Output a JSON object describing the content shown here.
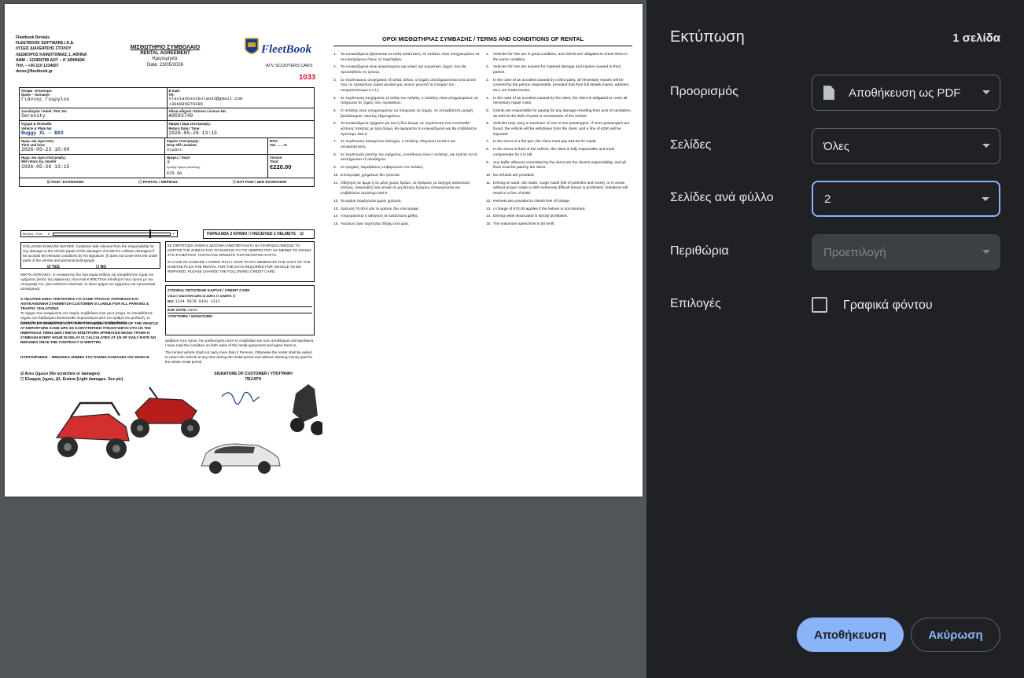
{
  "panel": {
    "title": "Εκτύπωση",
    "page_count": "1 σελίδα",
    "destination": {
      "label": "Προορισμός",
      "value": "Αποθήκευση ως PDF",
      "icon": "pdf-file-icon"
    },
    "pages": {
      "label": "Σελίδες",
      "value": "Όλες"
    },
    "pages_per_sheet": {
      "label": "Σελίδες ανά φύλλο",
      "value": "2"
    },
    "margins": {
      "label": "Περιθώρια",
      "value": "Προεπιλογή"
    },
    "options": {
      "label": "Επιλογές",
      "checkbox_label": "Γραφικά φόντου",
      "checked": false
    },
    "save_button": "Αποθήκευση",
    "cancel_button": "Ακύρωση",
    "accent": "#8ab4f8"
  },
  "contract": {
    "company_lines": [
      "Fleetbook Rentals",
      "FLEETBOOK SOFTWARE I.K.E.",
      "ΛΥΣΕΙΣ ΔΙΑΧΕΙΡΙΣΗΣ ΣΤΟΛΟΥ",
      "ΛΕΩΦΟΡΟΣ ΚΑΙΝΟΤΟΜΙΑΣ 1, ΑΘΗΝΑ",
      "ΑΦΜ – 123456789 ΔΟΥ – Α' ΑΘΗΝΩΝ",
      "ΤΗΛ – +30 210 1234567",
      "demo@fleetbook.gr"
    ],
    "title_gr": "ΜΙΣΘΩΤΗΡΙΟ ΣΥΜΒΟΛΑΙΟ",
    "title_en": "RENTAL AGREEMENT",
    "date_label": "Ημερομηνία:",
    "date_value": "Date: 23/05/2026",
    "brand": "FleetBook",
    "brand_sub": "ATV SCOOTERS CARS",
    "number": "1033",
    "fields": {
      "name_label": "Όνομα - Επώνυμο:",
      "name_label_en": "Name – Surname:",
      "name_value": "Γιάννης Γεωργίου",
      "email_label": "E-mail:",
      "tel_label": "Tel:",
      "email_value": "vlavianosnikolaos2@gmail.com",
      "tel_value": "+306985070285",
      "hotel_label": "Ξενοδοχείο / Hotel / Rm. No:",
      "hotel_value": "Serenity",
      "licence_label": "Άδεια οδηγού / Drivers Licence No:",
      "licence_value": "A0593749",
      "vehicle_label": "Όχημα & Πινακίδα",
      "vehicle_label_en": "Vehicle & Plate No:",
      "vehicle_value": "Buggy XL - B03",
      "return_label": "Ημέρα / Ώρα επιστροφής:",
      "return_label_en": "Return Date / Time:",
      "return_value": "2026-05-26 13:15",
      "out_label": "Ημερ. και ώρα ανάς:",
      "out_label_en": "Time and hour",
      "out_value": "2026-05-23 10:00",
      "dropoff_label": "Σημείο επιστροφής:",
      "dropoff_label_en": "Drop Off Location:",
      "dropoff_value": "Λιμάνι",
      "vat_label": "ΦΠΑ",
      "vat_label_en": "Vat: ……%",
      "willreturn_label": "Ημερ. και ώρα επιστροφής:",
      "willreturn_label_en": "Will return by, time/hr",
      "willreturn_value": "2026-05-26 13:15",
      "days_label": "Ημέρες / Days:",
      "days_value": "3",
      "daily_label": "Αμοιβή Ημέρα (Ανα/Day):",
      "daily_value": "€25.00",
      "total_label": "Σύνολο",
      "total_label_en": "Total:",
      "total_value": "€220.00"
    },
    "payment": [
      "☑ PAID / ΕΞΟΦΛΗΘΗ",
      "☐ PARTIAL / ΜΕΡΙΚΩΣ",
      "☐ NOT PAID / ΔΕΝ ΕΞΟΦΛΗΘΗ"
    ],
    "fuel_label": "Βενζίνη - Fuel",
    "fuel_e": "E",
    "fuel_f": "F",
    "fuel_level": 0.82,
    "helmets": "ΠΑΡΕΛΑΒΑ 2 ΚΡΑΝΗ / I RECEIVED 2 HELMETS",
    "cdw_text": "COLLISION DAMAGE WAIVER. Customer fully relieved from the responsibility for any damage to the vehicle (apart of the damages of € 800 for collision damages) if he accepts the relevant conditions by his signature. (It does not cover tires the under parts of the vehicle and personal belongings)",
    "yes_label": "☑ YES",
    "no_label": "☐ NO",
    "greek_cdw": "ΜΙΚΤΗ ΑΣΦΑΛΕΙΑ. Ο ενοικιαστής δεν έχει καμία ευθύνη για οποιαδήποτε ζημιά του οχήματος (εκτός της αφαίρεσης που είναι € 800) Όταν αποδεχτεί τους όρους με την υπογραφή του. (Δεν καλύπτει ελαστικά, το κάτω τμήμα του οχήματος και προσωπικά αντικείμενα).",
    "legal_text": "Ο ΠΕΛΑΤΗΣ ΕΙΝΑΙ ΥΠΕΥΘΥΝΟΣ ΓΙΑ ΚΑΘΕ ΤΡΟΧΑΙΑ ΠΑΡΑΒΑΣΗ ΚΑΙ ΑΝΤΙΚΑΝΟΝΙΚΗ ΣΤΑΘΜΕΥΣΗ CUSTOMER IS LIABLE FOR ALL PARKING & TRAFFIC VIOLATIONS",
    "legal_sub": "Το όχημα που αναφέρεται στο παρόν συμβόλαιο είναι για 2 άτομα. Σε οποιαδήποτε σημείο του διαδρόμου διαπιστωθεί περισσότεροι από τον αριθμό του μισθωτή, το όχημα θα του αφαιρείται και επιστρέφονται τα χρήματα αδειοδοσίας.",
    "conditions_text": "ΚΑΤΑΣΤΑΣΗ ΟΧΗΜΑΤΟΣ ΚΑΤΑ ΤΗΝ ΠΑΡΑΔΟΣΗ. CONDITIONS OF THE VEHICLE AT DEPARTURE ΚΑΘΕ ΩΡΑ ΣΕ ΚΑΘΥΣΤΕΡΗΣΗ ΥΠΟΛΟΓΙΖΕΤΑΙ ΣΤΟ 1/5 ΤΗΣ ΗΜΕΡΗΣΙΑΣ ΤΙΜΗΣ ΔΕΝ ΓΙΝΕΤΑΙ ΕΠΙΣΤΡΟΦΗ ΧΡΗΜΑΤΩΝ ΜΟΝΟ ΓΡΑΦΗ Η ΣΥΜΒΑΣΗ EVERY HOUR IN DELAY IS CALCULATED AT 1/5 OF DAILY RATE NO REFUNDS ONCE THE CONTRACT IS WRITTEN",
    "remarks_text": "ΠΑΡΑΤΗΡΗΣΕΙΣ – REMARKS ΖΗΜΙΕΣ ΣΤΟ ΟΧΗΜΑ DAMAGES ON VEHICLE",
    "damage_none": "☑ Άνευ ζημιών (No scratches or damages)",
    "damage_light": "☐ Ελαφρές ζημιές, βλ. Εικόνα (Light damages. See pic)",
    "accident_gr": "ΣΕ ΠΕΡΙΠΤΩΣΗ ΖΗΜΙΑΣ ΔΕΧΟΜΑΙ ΑΝΕΠΙΦΥΛΑΚΤΑ ΝΑ ΠΛΗΡΩΣΩ ΑΜΕΣΩΣ ΤΟ ΚΟΣΤΟΣ ΤΗΣ ΖΗΜΙΑΣ ΣΥΝ ΤΟ ΕΝΟΙΚΙΟ ΓΙΑ ΤΙΣ ΗΜΕΡΕΣ ΠΟΥ ΘΑ ΜΕΙΝΕΙ ΤΟ ΟΧΗΜΑ ΣΤΟ ΣΥΝΕΡΓΕΙΟ. ΠΑΡΑΚΑΛΩ ΧΡΕΩΣΤΕ ΤΗΝ ΠΙΣΤΩΤΙΚΗ ΚΑΡΤΑ.",
    "accident_en": "IN CASE OF DAMAGE I AGREE THAT I HAVE TO PAY IMMEDIATE THE COST OF THE DAMAGE PLUS THE RENTAL FOR THE DAYS REQUIRED FOR VEHICLE TO BE REPAIRED. PLEASE CHARGE THE FOLLOWING CREDIT CARD.",
    "card_title": "ΣΤΟΙΧΕΙΑ ΠΙΣΤΩΤΙΚΗΣ ΚΑΡΤΑΣ / CREDIT CARD",
    "card_types": "VISA ☐   MASTERCARD ☑   AMEX ☐   DINERS ☐",
    "card_no_label": "NO:",
    "card_no": "1234 5678 9101 1111",
    "exp_label": "EXP. DATE:",
    "exp_value": "04/29",
    "signature_label": "ΥΠΟΓΡΑΦΗ / SIGNATURE:",
    "sign_note_gr": "Διάβασα τους όρους του μισθωτηρίου αυτό το συμβόλαιο και τους αποδέχομαι ανεπιφύλακτα.",
    "sign_note_en": "I have read the condition on both sides of the rental agreement and agree them to.",
    "sign_note_2": "The rented vehicle shall not carry more than 2 Persons. Otherwise the renter shall be asked to return the vehicle at any time during the rental period and without claiming money paid for the whole rental period",
    "customer_signature": "SIGNATURE OF CUSTOMER / ΥΠΟΓΡΑΦΗ ΠΕΛΑΤΗ"
  },
  "terms": {
    "title": "ΟΡΟΙ ΜΙΣΘΩΤΗΡΙΑΣ ΣΥΜΒΑΣΗΣ / TERMS AND CONDITIONS OF RENTAL",
    "gr": [
      "Τα ενοικιαζόμενα βρίσκονται σε καλή κατάσταση. Οι πελάτες είναι υποχρεωμένοι να τα επιστρέφουν όπως τα παρέλαβαν.",
      "Τα ενοικιαζόμενα είναι ασφαλισμένα για υλικές και σωματικές ζημιές που θα προκληθούν σε τρίτους.",
      "Σε περιπτώσεις ατυχήματος εξ αιτίας άλλου, οι ζημιές αποζημιώνονται από αυτόν που τις προκάλεσε (αφού φυσικά μας γίνουν γνωστά τα στοιχεία του, ονοματεπώνυμο κ.τ.λ.).",
      "Σε περίπτωση ατυχήματος εξ αιτίας του πελάτη, ο πελάτης είναι υποχρεωμένος να πληρώσει τις ζημιές που προκάλεσε.",
      "Ο πελάτης είναι υποχρεωμένος να πληρώσει τις ζημιές, σε οποιαδήποτε μορφή βανδαλισμού, κλοπής εξαρτημάτων.",
      "Τα ενοικιαζόμενα οχήματα για ένα ή δύο άτομα, σε περίπτωση που εντοπισθεί κάποιος πελάτης με τρία άτομα, θα αφαιρείται το ενοικιαζόμενο και θα επιβάλλεται πρόστιμο 250 €.",
      "Σε περίπτωση σκασμένου λάστιχου, ο πελάτης πληρώνει 15,00 € για αποκατάσταση.",
      "Σε περίπτωση κλοπής του οχήματος, υπεύθυνος είναι ο πελάτης, και πρέπει να το αποζημιώσει εξ ολοκλήρου.",
      "Οι τροχαίες παραβάσεις επιβαρύνουν τον πελάτη.",
      "Επιστροφές χρημάτων δεν γίνονται.",
      "Οδήγηση σε άμμο ή σε μέρη χωρίς δρόμο, σε δρόμους με άσχημη κατάσταση (πέτρες, λακκούβες) και γενικά σε μη βατούς δρόμους απαγορεύεται και επιβάλλεται πρόστιμο 250 €.",
      "Τα κράνη παρέχονται χωρίς χρέωση.",
      "Χρέωση 70,00 € εάν το κράνος δεν επιστραφεί.",
      "Απαγορεύεται η οδήγηση σε κατάσταση μέθης.",
      "Ανώτερο όριο ταχύτητας 50χλμ ανά ώρα."
    ],
    "en": [
      "Vehicles for hire are in good condition, and clients are obligated to return them in the same condition.",
      "Vehicles for hire are insured for material damage and injuries caused to third parties.",
      "In the case of an accident caused by a third party, all necessary repairs will be covered by the person responsible, provided that their full details (name, address, etc.) are made known.",
      "In the case of an accident caused by the client, the client is obligated to cover all necessary repair costs.",
      "Clients are responsible for paying for any damage resulting from acts of vandalism, as well as the theft of parts or accessories of the vehicle.",
      "Vehicles may carry a maximum of one or two passengers. If more passengers are found, the vehicle will be withdrawn from the client, and a fine of €250 will be imposed.",
      "In the event of a flat tyre, the client must pay €15.00 for repair.",
      "In the event of theft of the vehicle, the client is fully responsible and must compensate for it in full.",
      "Any traffic offences committed by the client are the client's responsibility, and all fines must be paid by the client.",
      "No refunds are provided.",
      "Driving on sand, dirt roads, rough roads (full of potholes and rocks), or in areas without proper roads or with extremely difficult terrain is prohibited. Violations will result in a fine of €250.",
      "Helmets are provided to clients free of charge.",
      "A charge of €70.00 applies if the helmet is not returned.",
      "Driving while intoxicated is strictly prohibited.",
      "The maximum speed limit is 50 km/h."
    ]
  }
}
